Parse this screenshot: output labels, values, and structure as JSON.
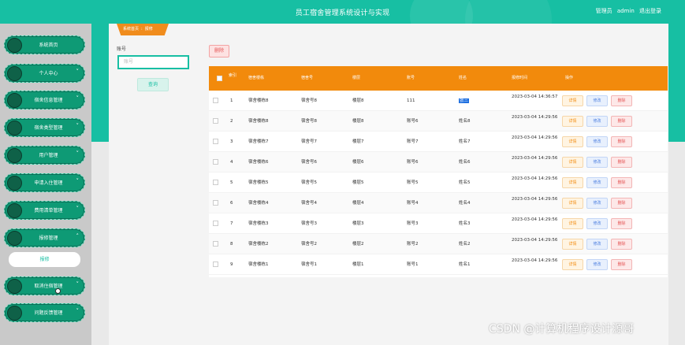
{
  "header": {
    "title": "员工宿舍管理系统设计与实现",
    "role": "管理员",
    "username": "admin",
    "logout": "退出登录"
  },
  "sidebar": {
    "items": [
      {
        "label": "系统首页",
        "has_chevron": false
      },
      {
        "label": "个人中心",
        "has_chevron": true
      },
      {
        "label": "宿舍信息管理",
        "has_chevron": true
      },
      {
        "label": "宿舍类型管理",
        "has_chevron": true
      },
      {
        "label": "用户管理",
        "has_chevron": true
      },
      {
        "label": "申请入住管理",
        "has_chevron": true
      },
      {
        "label": "费用清单管理",
        "has_chevron": true
      },
      {
        "label": "报修管理",
        "has_chevron": true,
        "expanded": true
      },
      {
        "label": "取消住宿管理",
        "has_chevron": true
      },
      {
        "label": "问题反馈管理",
        "has_chevron": true
      }
    ],
    "sub_item": "报修"
  },
  "breadcrumb": {
    "home": "系统首页",
    "sep": ":",
    "current": "报修"
  },
  "search": {
    "label": "账号",
    "placeholder": "账号",
    "button": "查询"
  },
  "toolbar": {
    "delete_label": "删除"
  },
  "table": {
    "headers": {
      "index": "索引",
      "building": "宿舍楼栋",
      "dorm_no": "宿舍号",
      "floor": "楼层",
      "account": "账号",
      "name": "姓名",
      "time": "报修时间",
      "actions": "操作"
    },
    "rows": [
      {
        "idx": "1",
        "building": "宿舍楼栋8",
        "dorm_no": "宿舍号8",
        "floor": "楼层8",
        "account": "111",
        "name": "张三",
        "time": "2023-03-04 14:36:57"
      },
      {
        "idx": "2",
        "building": "宿舍楼栋8",
        "dorm_no": "宿舍号8",
        "floor": "楼层8",
        "account": "账号6",
        "name": "姓名8",
        "time": "2023-03-04 14:29:56"
      },
      {
        "idx": "3",
        "building": "宿舍楼栋7",
        "dorm_no": "宿舍号7",
        "floor": "楼层7",
        "account": "账号7",
        "name": "姓名7",
        "time": "2023-03-04 14:29:56"
      },
      {
        "idx": "4",
        "building": "宿舍楼栋6",
        "dorm_no": "宿舍号6",
        "floor": "楼层6",
        "account": "账号6",
        "name": "姓名6",
        "time": "2023-03-04 14:29:56"
      },
      {
        "idx": "5",
        "building": "宿舍楼栋5",
        "dorm_no": "宿舍号5",
        "floor": "楼层5",
        "account": "账号5",
        "name": "姓名5",
        "time": "2023-03-04 14:29:56"
      },
      {
        "idx": "6",
        "building": "宿舍楼栋4",
        "dorm_no": "宿舍号4",
        "floor": "楼层4",
        "account": "账号4",
        "name": "姓名4",
        "time": "2023-03-04 14:29:56"
      },
      {
        "idx": "7",
        "building": "宿舍楼栋3",
        "dorm_no": "宿舍号3",
        "floor": "楼层3",
        "account": "账号3",
        "name": "姓名3",
        "time": "2023-03-04 14:29:56"
      },
      {
        "idx": "8",
        "building": "宿舍楼栋2",
        "dorm_no": "宿舍号2",
        "floor": "楼层2",
        "account": "账号2",
        "name": "姓名2",
        "time": "2023-03-04 14:29:56"
      },
      {
        "idx": "9",
        "building": "宿舍楼栋1",
        "dorm_no": "宿舍号1",
        "floor": "楼层1",
        "account": "账号1",
        "name": "姓名1",
        "time": "2023-03-04 14:29:56"
      }
    ],
    "actions": {
      "detail": "详情",
      "edit": "修改",
      "delete": "删除"
    }
  },
  "watermark": "CSDN @计算机程序设计源哥",
  "colors": {
    "accent": "#17bfa3",
    "menu": "#0e9a75",
    "table_header": "#f28a0c",
    "danger": "#e45656"
  }
}
